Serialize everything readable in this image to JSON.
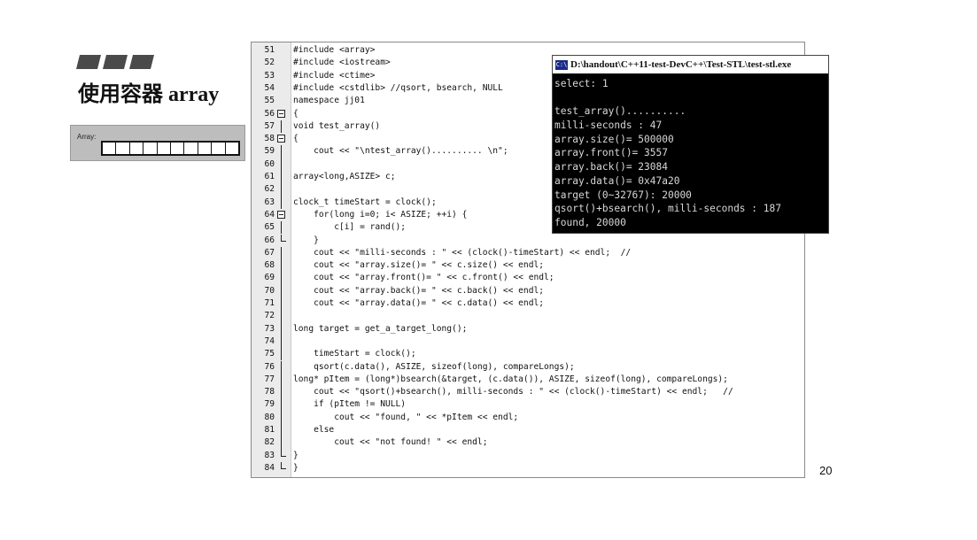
{
  "slide": {
    "title": "使用容器 array",
    "page_number": "20"
  },
  "array_diagram": {
    "label": "Array:",
    "cell_count": 10
  },
  "code_panel": {
    "lines": [
      {
        "num": "51",
        "text": "#include <array>"
      },
      {
        "num": "52",
        "text": "#include <iostream>"
      },
      {
        "num": "53",
        "text": "#include <ctime>"
      },
      {
        "num": "54",
        "text": "#include <cstdlib> //qsort, bsearch, NULL"
      },
      {
        "num": "55",
        "text": "namespace jj01"
      },
      {
        "num": "56",
        "text": "{"
      },
      {
        "num": "57",
        "text": "void test_array()"
      },
      {
        "num": "58",
        "text": "{"
      },
      {
        "num": "59",
        "text": "    cout << \"\\ntest_array().......... \\n\";"
      },
      {
        "num": "60",
        "text": ""
      },
      {
        "num": "61",
        "text": "array<long,ASIZE> c;"
      },
      {
        "num": "62",
        "text": ""
      },
      {
        "num": "63",
        "text": "clock_t timeStart = clock();"
      },
      {
        "num": "64",
        "text": "    for(long i=0; i< ASIZE; ++i) {"
      },
      {
        "num": "65",
        "text": "        c[i] = rand();"
      },
      {
        "num": "66",
        "text": "    }"
      },
      {
        "num": "67",
        "text": "    cout << \"milli-seconds : \" << (clock()-timeStart) << endl;  //"
      },
      {
        "num": "68",
        "text": "    cout << \"array.size()= \" << c.size() << endl;"
      },
      {
        "num": "69",
        "text": "    cout << \"array.front()= \" << c.front() << endl;"
      },
      {
        "num": "70",
        "text": "    cout << \"array.back()= \" << c.back() << endl;"
      },
      {
        "num": "71",
        "text": "    cout << \"array.data()= \" << c.data() << endl;"
      },
      {
        "num": "72",
        "text": ""
      },
      {
        "num": "73",
        "text": "long target = get_a_target_long();"
      },
      {
        "num": "74",
        "text": ""
      },
      {
        "num": "75",
        "text": "    timeStart = clock();"
      },
      {
        "num": "76",
        "text": "    qsort(c.data(), ASIZE, sizeof(long), compareLongs);"
      },
      {
        "num": "77",
        "text": "long* pItem = (long*)bsearch(&target, (c.data()), ASIZE, sizeof(long), compareLongs);"
      },
      {
        "num": "78",
        "text": "    cout << \"qsort()+bsearch(), milli-seconds : \" << (clock()-timeStart) << endl;   //"
      },
      {
        "num": "79",
        "text": "    if (pItem != NULL)"
      },
      {
        "num": "80",
        "text": "        cout << \"found, \" << *pItem << endl;"
      },
      {
        "num": "81",
        "text": "    else"
      },
      {
        "num": "82",
        "text": "        cout << \"not found! \" << endl;"
      },
      {
        "num": "83",
        "text": "}"
      },
      {
        "num": "84",
        "text": "}"
      }
    ]
  },
  "console": {
    "icon_text": "C:\\",
    "title": "D:\\handout\\C++11-test-DevC++\\Test-STL\\test-stl.exe",
    "lines": [
      "select: 1",
      "",
      "test_array()..........",
      "milli-seconds : 47",
      "array.size()= 500000",
      "array.front()= 3557",
      "array.back()= 23084",
      "array.data()= 0x47a20",
      "target (0~32767): 20000",
      "qsort()+bsearch(), milli-seconds : 187",
      "found, 20000"
    ]
  }
}
